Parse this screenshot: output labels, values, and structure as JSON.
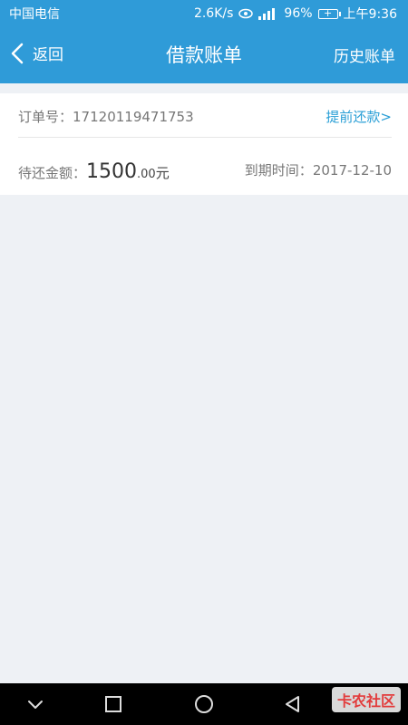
{
  "status_bar": {
    "carrier": "中国电信",
    "speed": "2.6K/s",
    "battery": "96%",
    "time": "上午9:36"
  },
  "nav": {
    "back_label": "返回",
    "title": "借款账单",
    "history_label": "历史账单"
  },
  "bill": {
    "order_label": "订单号：",
    "order_no": "17120119471753",
    "prepay_link": "提前还款>",
    "amount_label": "待还金额：",
    "amount_integer": "1500",
    "amount_decimal": ".00",
    "amount_unit": "元",
    "due_label": "到期时间：",
    "due_date": "2017-12-10"
  },
  "watermark": {
    "text": "卡农社区"
  },
  "colors": {
    "primary": "#2f9bd8",
    "link": "#2a9fd6",
    "background": "#eef1f5"
  }
}
